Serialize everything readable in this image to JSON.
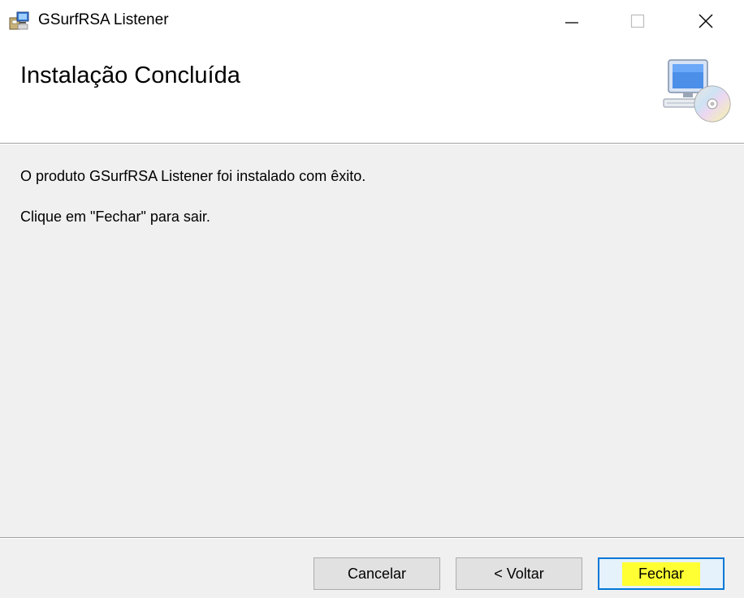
{
  "window": {
    "title": "GSurfRSA Listener",
    "controls": {
      "minimize_icon": "minimize-icon",
      "maximize_icon": "maximize-icon",
      "close_icon": "close-icon"
    }
  },
  "header": {
    "title": "Instalação Concluída",
    "graphic_icon": "computer-cd-icon"
  },
  "content": {
    "message_1": "O produto GSurfRSA Listener foi instalado com êxito.",
    "message_2": "Clique em \"Fechar\" para sair."
  },
  "buttons": {
    "cancel": "Cancelar",
    "back": "< Voltar",
    "close": "Fechar"
  },
  "colors": {
    "highlight": "#ffff33",
    "focus_border": "#0078d7",
    "dialog_bg": "#f0f0f0"
  }
}
